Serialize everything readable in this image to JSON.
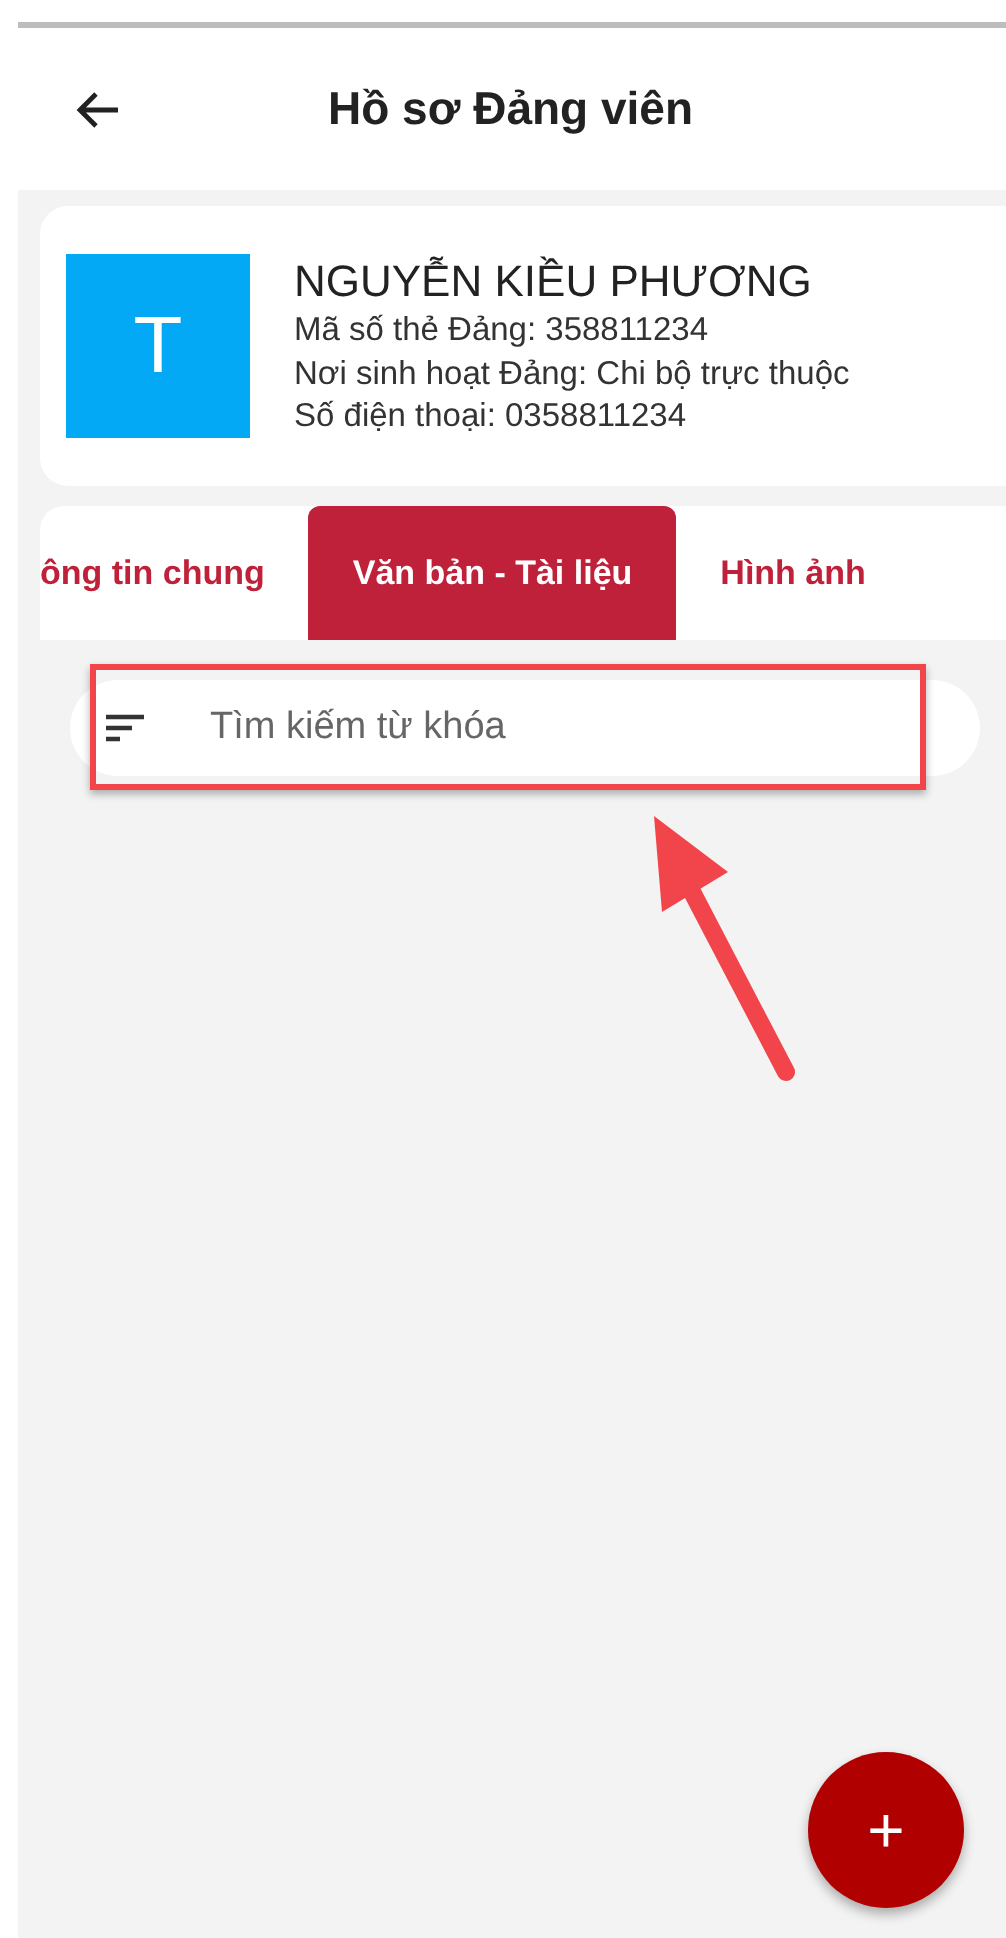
{
  "header": {
    "title": "Hồ sơ Đảng viên"
  },
  "profile": {
    "avatar_letter": "T",
    "name": "NGUYỄN KIỀU PHƯƠNG",
    "lines": [
      "Mã số thẻ Đảng: 358811234",
      "Nơi sinh hoạt Đảng: Chi bộ trực thuộc",
      "Số điện thoại: 0358811234"
    ]
  },
  "tabs": [
    {
      "label": "ông tin chung",
      "selected": false
    },
    {
      "label": "Văn bản - Tài liệu",
      "selected": true
    },
    {
      "label": "Hình ảnh",
      "selected": false
    }
  ],
  "search": {
    "placeholder": "Tìm kiếm từ khóa"
  },
  "fab": {
    "label": "+"
  },
  "annotation": {
    "frame": true,
    "arrow": true
  }
}
